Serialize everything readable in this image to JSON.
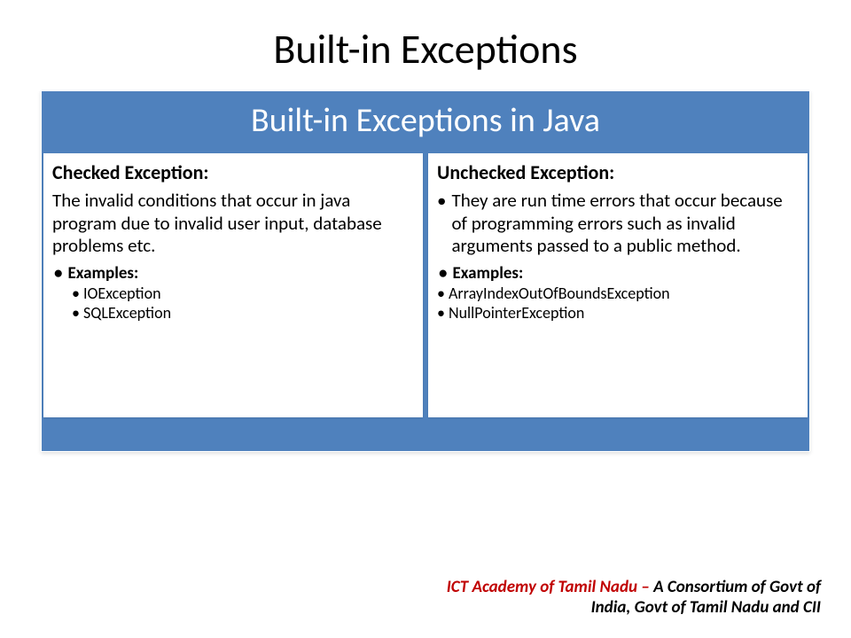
{
  "slide": {
    "title": "Built-in Exceptions",
    "panel_title": "Built-in Exceptions in Java"
  },
  "left": {
    "heading": "Checked Exception:",
    "desc": "The invalid conditions that occur in java program due to invalid user input, database problems etc.",
    "examples_label": "Examples:",
    "items": [
      "IOException",
      "SQLException"
    ]
  },
  "right": {
    "heading": "Unchecked Exception:",
    "desc": "They are run time errors that occur because of programming errors such as invalid arguments passed to a public method.",
    "examples_label": "Examples:",
    "items": [
      "ArrayIndexOutOfBoundsException",
      "NullPointerException"
    ]
  },
  "footer": {
    "org": "ICT Academy of Tamil Nadu – ",
    "tagline1": "A Consortium of Govt of",
    "tagline2": "India, Govt of Tamil Nadu and CII"
  }
}
